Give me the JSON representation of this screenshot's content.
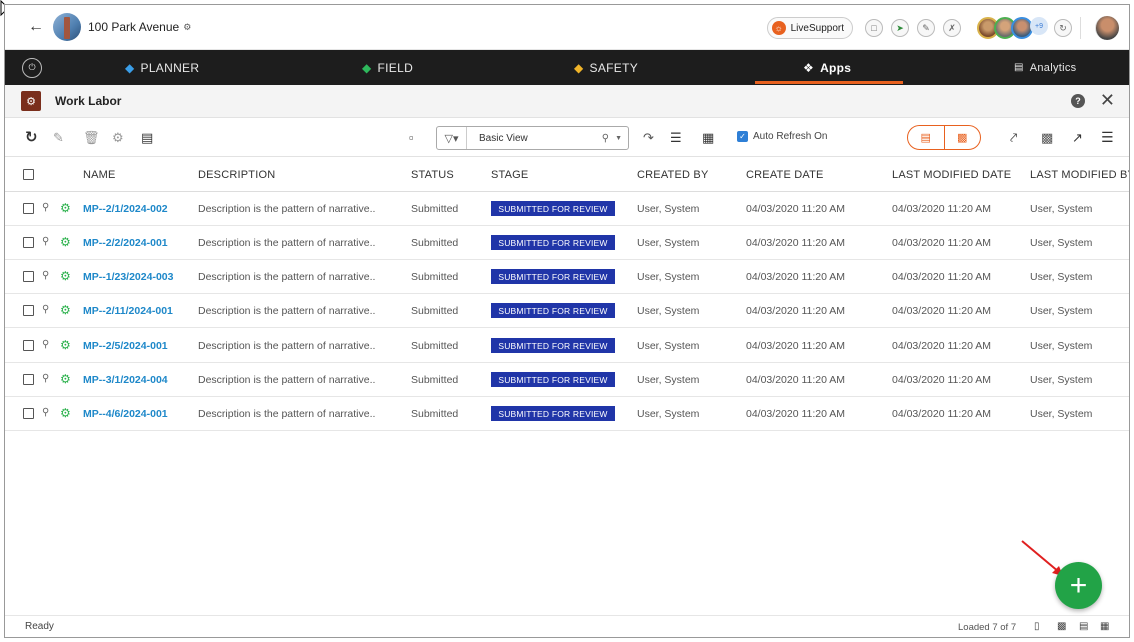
{
  "header": {
    "back_icon": "arrow-left-icon",
    "project_name": "100 Park Avenue",
    "live_support_label": "LiveSupport",
    "participants_more": "+9"
  },
  "nav": {
    "items": [
      {
        "label": "PLANNER",
        "icon": "planner-icon"
      },
      {
        "label": "FIELD",
        "icon": "field-icon"
      },
      {
        "label": "SAFETY",
        "icon": "safety-icon"
      },
      {
        "label": "Apps",
        "icon": "apps-icon",
        "active": true
      },
      {
        "label": "Analytics",
        "icon": "analytics-icon"
      }
    ],
    "accent": "#e8611f"
  },
  "module": {
    "title": "Work Labor"
  },
  "toolbar": {
    "view_value": "Basic View",
    "auto_refresh_label": "Auto Refresh On",
    "auto_refresh_checked": true
  },
  "table": {
    "columns": [
      "NAME",
      "DESCRIPTION",
      "STATUS",
      "STAGE",
      "CREATED BY",
      "CREATE DATE",
      "LAST MODIFIED DATE",
      "LAST MODIFIED BY"
    ],
    "rows": [
      {
        "name": "MP--2/1/2024-002",
        "description": "Description is the pattern of narrative..",
        "status": "Submitted",
        "stage": "SUBMITTED FOR REVIEW",
        "created_by": "User, System",
        "create_date": "04/03/2020 11:20 AM",
        "last_modified_date": "04/03/2020 11:20 AM",
        "last_modified_by": "User, System"
      },
      {
        "name": "MP--2/2/2024-001",
        "description": "Description is the pattern of narrative..",
        "status": "Submitted",
        "stage": "SUBMITTED FOR REVIEW",
        "created_by": "User, System",
        "create_date": "04/03/2020 11:20 AM",
        "last_modified_date": "04/03/2020 11:20 AM",
        "last_modified_by": "User, System"
      },
      {
        "name": "MP--1/23/2024-003",
        "description": "Description is the pattern of narrative..",
        "status": "Submitted",
        "stage": "SUBMITTED FOR REVIEW",
        "created_by": "User, System",
        "create_date": "04/03/2020 11:20 AM",
        "last_modified_date": "04/03/2020 11:20 AM",
        "last_modified_by": "User, System"
      },
      {
        "name": "MP--2/11/2024-001",
        "description": "Description is the pattern of narrative..",
        "status": "Submitted",
        "stage": "SUBMITTED FOR REVIEW",
        "created_by": "User, System",
        "create_date": "04/03/2020 11:20 AM",
        "last_modified_date": "04/03/2020 11:20 AM",
        "last_modified_by": "User, System"
      },
      {
        "name": "MP--2/5/2024-001",
        "description": "Description is the pattern of narrative..",
        "status": "Submitted",
        "stage": "SUBMITTED FOR REVIEW",
        "created_by": "User, System",
        "create_date": "04/03/2020 11:20 AM",
        "last_modified_date": "04/03/2020 11:20 AM",
        "last_modified_by": "User, System"
      },
      {
        "name": "MP--3/1/2024-004",
        "description": "Description is the pattern of narrative..",
        "status": "Submitted",
        "stage": "SUBMITTED FOR REVIEW",
        "created_by": "User, System",
        "create_date": "04/03/2020 11:20 AM",
        "last_modified_date": "04/03/2020 11:20 AM",
        "last_modified_by": "User, System"
      },
      {
        "name": "MP--4/6/2024-001",
        "description": "Description is the pattern of narrative..",
        "status": "Submitted",
        "stage": "SUBMITTED FOR REVIEW",
        "created_by": "User, System",
        "create_date": "04/03/2020 11:20 AM",
        "last_modified_date": "04/03/2020 11:20 AM",
        "last_modified_by": "User, System"
      }
    ],
    "stage_color": "#2035a8",
    "link_color": "#1e88c9"
  },
  "footer": {
    "status": "Ready",
    "loaded": "Loaded 7 of 7"
  },
  "fab": {
    "label": "+",
    "color": "#22a347"
  }
}
